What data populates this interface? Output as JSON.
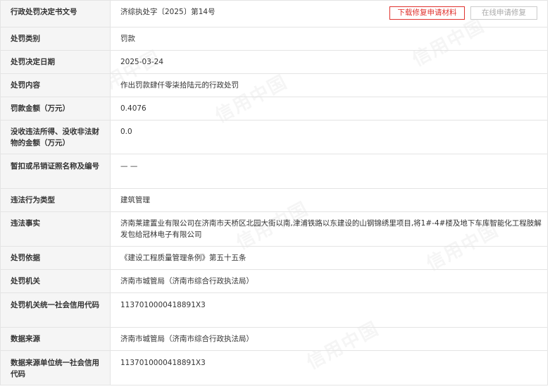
{
  "watermark": "信用中国",
  "document_number": {
    "label": "行政处罚决定书文号",
    "value": "济综执处字〔2025〕第14号",
    "download_button": "下载修复申请材料",
    "online_button": "在线申请修复"
  },
  "rows": [
    {
      "label": "处罚类别",
      "value": "罚款"
    },
    {
      "label": "处罚决定日期",
      "value": "2025-03-24"
    },
    {
      "label": "处罚内容",
      "value": "作出罚款肆仟零柒拾陆元的行政处罚"
    },
    {
      "label": "罚款金额（万元）",
      "value": "0.4076"
    },
    {
      "label": "没收违法所得、没收非法财物的金额（万元）",
      "value": "0.0"
    },
    {
      "label": "暂扣或吊销证照名称及编号",
      "value": "— —"
    },
    {
      "label": "违法行为类型",
      "value": "建筑管理"
    },
    {
      "label": "违法事实",
      "value": "济南莱建置业有限公司在济南市天桥区北园大街以南,津浦铁路以东建设的山钢锦绣里项目,将1#-4#楼及地下车库智能化工程肢解发包给冠林电子有限公司"
    },
    {
      "label": "处罚依据",
      "value": "《建设工程质量管理条例》第五十五条"
    },
    {
      "label": "处罚机关",
      "value": "济南市城管局（济南市综合行政执法局）"
    },
    {
      "label": "处罚机关统一社会信用代码",
      "value": "11370100004188​91X3"
    },
    {
      "label": "数据来源",
      "value": "济南市城管局（济南市综合行政执法局）"
    },
    {
      "label": "数据来源单位统一社会信用代码",
      "value": "11370100004188​91X3"
    }
  ]
}
